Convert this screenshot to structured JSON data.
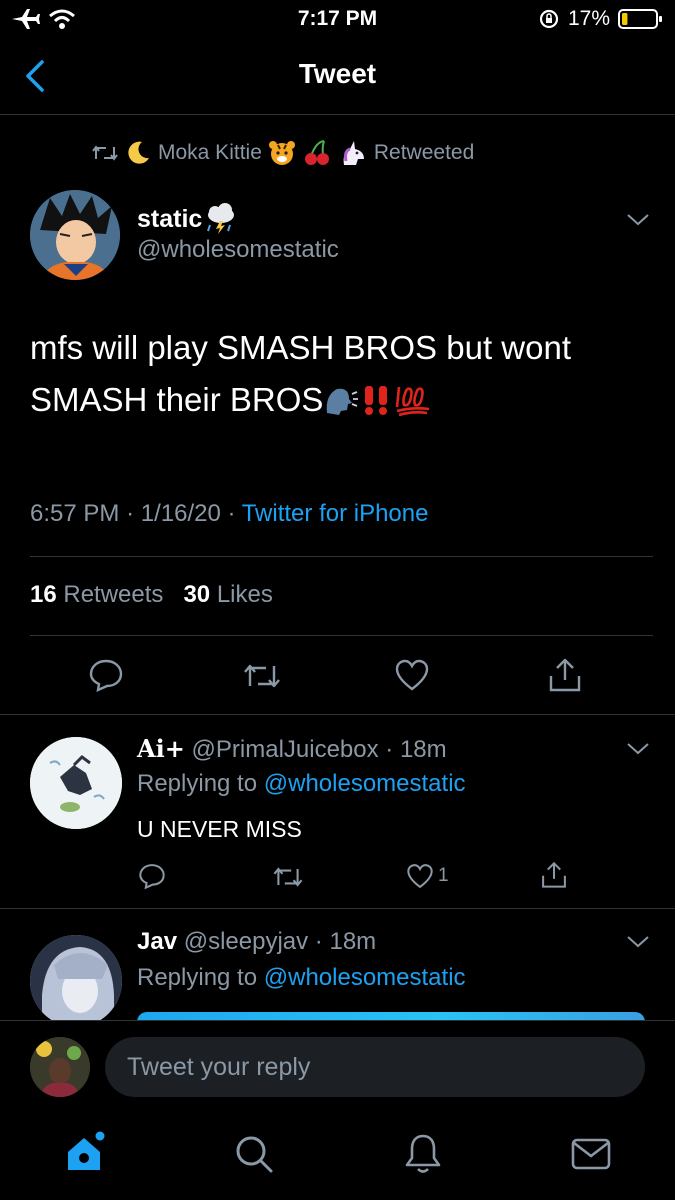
{
  "status_bar": {
    "time": "7:17 PM",
    "battery_pct": "17%",
    "battery_level": 0.17
  },
  "nav": {
    "title": "Tweet"
  },
  "retweet_line": {
    "user": "Moka Kittie",
    "label": "Retweeted"
  },
  "tweet": {
    "author_name": "static",
    "author_handle": "@wholesomestatic",
    "text_line1": "mfs will play SMASH BROS but wont",
    "text_line2": "SMASH their BROS",
    "time": "6:57 PM",
    "date": "1/16/20",
    "source": "Twitter for iPhone",
    "retweet_count": "16",
    "retweet_label": "Retweets",
    "like_count": "30",
    "like_label": "Likes"
  },
  "replies": [
    {
      "name": "Ai+",
      "handle": "@PrimalJuicebox",
      "age": "18m",
      "replying_label": "Replying to",
      "replying_to": "@wholesomestatic",
      "text": "U NEVER MISS",
      "like_count": "1"
    },
    {
      "name": "Jav",
      "handle": "@sleepyjav",
      "age": "18m",
      "replying_label": "Replying to",
      "replying_to": "@wholesomestatic"
    }
  ],
  "reply_box": {
    "placeholder": "Tweet your reply"
  },
  "colors": {
    "accent": "#1da1f2",
    "secondary_text": "#8b98a5",
    "background": "#000000",
    "divider": "#2f3336"
  }
}
